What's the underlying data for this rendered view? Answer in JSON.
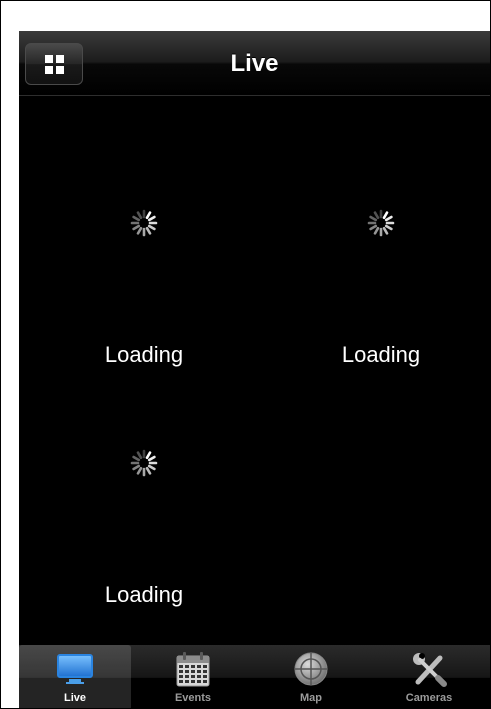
{
  "navbar": {
    "title": "Live",
    "menu_icon": "grid-icon"
  },
  "tiles": [
    {
      "status": "Loading",
      "icon": "spinner-icon"
    },
    {
      "status": "Loading",
      "icon": "spinner-icon"
    },
    {
      "status": "Loading",
      "icon": "spinner-icon"
    }
  ],
  "tabbar": {
    "active": "Live",
    "tabs": [
      {
        "label": "Live",
        "icon": "monitor-icon"
      },
      {
        "label": "Events",
        "icon": "calendar-icon"
      },
      {
        "label": "Map",
        "icon": "globe-icon"
      },
      {
        "label": "Cameras",
        "icon": "tools-icon"
      }
    ]
  },
  "colors": {
    "background": "#000000",
    "text": "#ffffff",
    "tab_active_icon": "#4a9ee8",
    "tab_inactive_icon": "#9b9b9b"
  }
}
